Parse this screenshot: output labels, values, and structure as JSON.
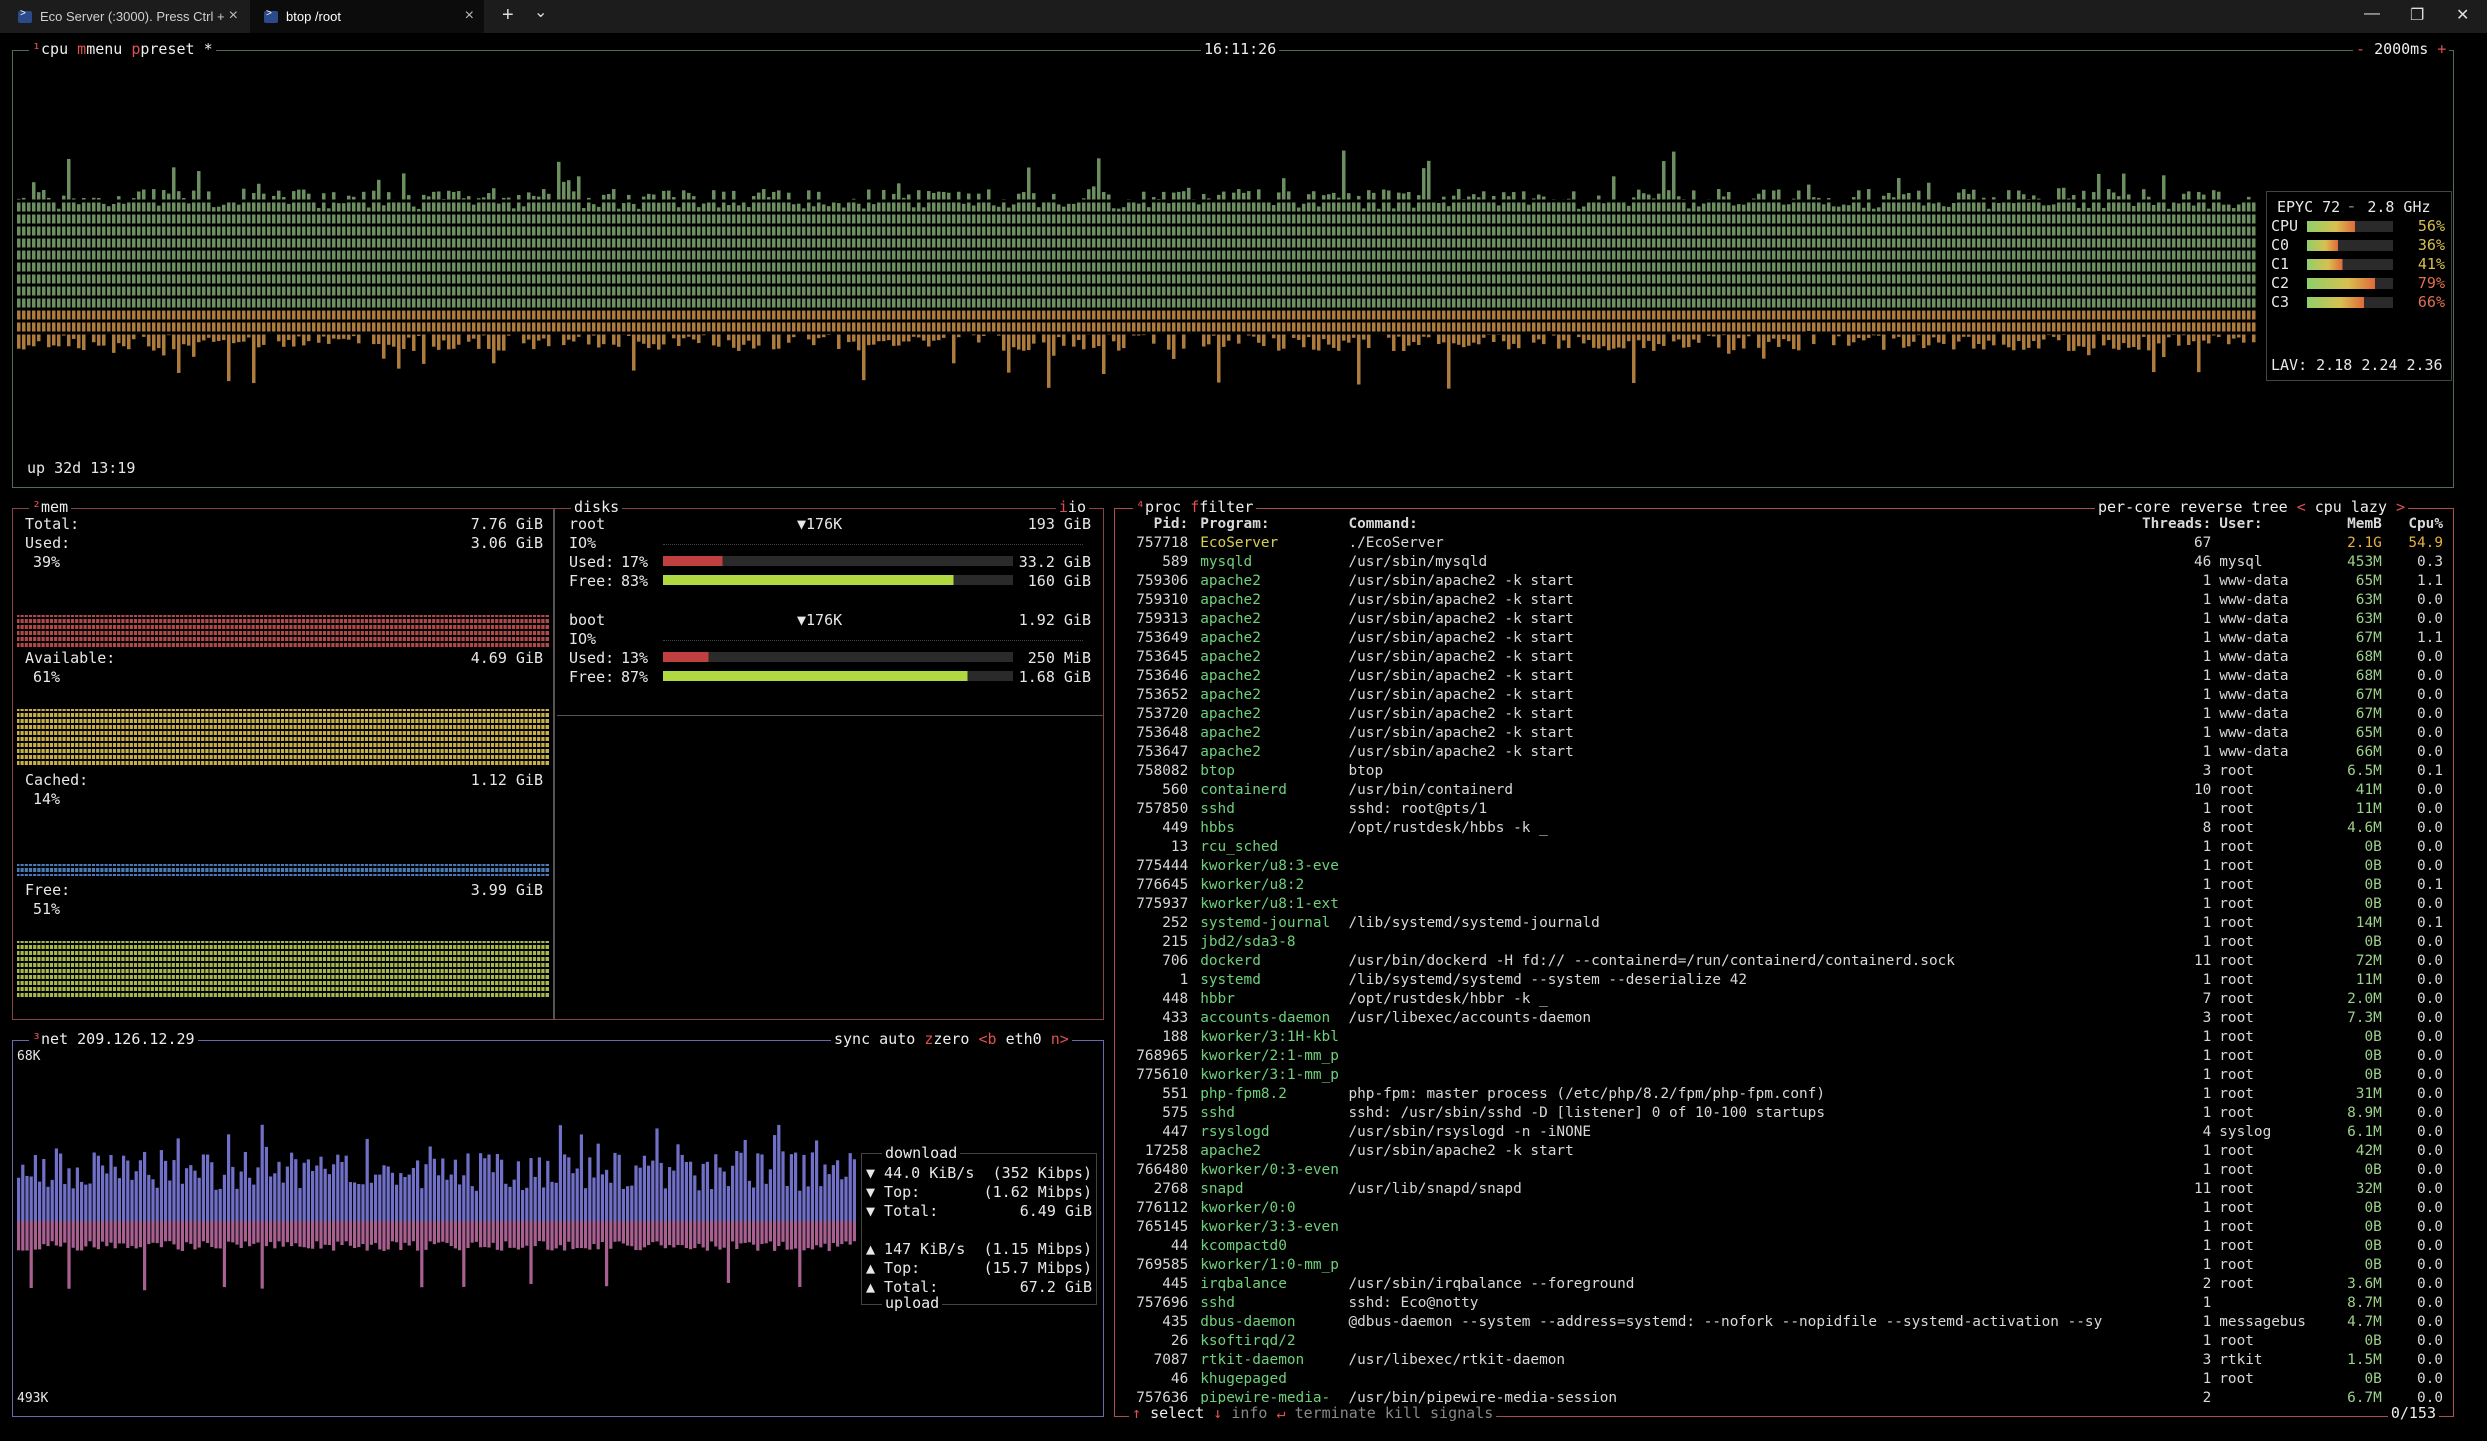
{
  "window": {
    "tabs": [
      {
        "label": "Eco Server (:3000). Press Ctrl +",
        "active": false
      },
      {
        "label": "btop /root",
        "active": true
      }
    ],
    "new_tab": "+",
    "dropdown": "⌄",
    "minimize": "—",
    "maximize": "❐",
    "close": "✕"
  },
  "cpu": {
    "title": "cpu",
    "menu": "menu",
    "preset": "preset *",
    "clock": "16:11:26",
    "interval": "2000ms",
    "uptime": "up 32d 13:19",
    "model": "EPYC 72",
    "freq": "2.8 GHz",
    "rows": [
      {
        "label": "CPU",
        "pct": "56%",
        "value": 56
      },
      {
        "label": "C0",
        "pct": "36%",
        "value": 36
      },
      {
        "label": "C1",
        "pct": "41%",
        "value": 41
      },
      {
        "label": "C2",
        "pct": "79%",
        "value": 79
      },
      {
        "label": "C3",
        "pct": "66%",
        "value": 66
      }
    ],
    "lav_label": "LAV:",
    "lav": [
      "2.18",
      "2.24",
      "2.36"
    ]
  },
  "mem": {
    "title": "mem",
    "total_label": "Total:",
    "total": "7.76 GiB",
    "used_label": "Used:",
    "used": "3.06 GiB",
    "used_pct": "39%",
    "available_label": "Available:",
    "available": "4.69 GiB",
    "available_pct": "61%",
    "cached_label": "Cached:",
    "cached": "1.12 GiB",
    "cached_pct": "14%",
    "free_label": "Free:",
    "free": "3.99 GiB",
    "free_pct": "51%"
  },
  "disks": {
    "title": "disks",
    "io_tag": "io",
    "items": [
      {
        "name": "root",
        "io_val": "▼176K",
        "size": "193 GiB",
        "io_label": "IO%",
        "used_label": "Used:",
        "used_pct": "17%",
        "used": "33.2 GiB",
        "used_frac": 0.17,
        "free_label": "Free:",
        "free_pct": "83%",
        "free": "160 GiB",
        "free_frac": 0.83
      },
      {
        "name": "boot",
        "io_val": "▼176K",
        "size": "1.92 GiB",
        "io_label": "IO%",
        "used_label": "Used:",
        "used_pct": "13%",
        "used": "250 MiB",
        "used_frac": 0.13,
        "free_label": "Free:",
        "free_pct": "87%",
        "free": "1.68 GiB",
        "free_frac": 0.87
      }
    ]
  },
  "net": {
    "title": "net",
    "ip": "209.126.12.29",
    "sync": "sync",
    "auto": "auto",
    "zero": "zero",
    "prev": "<b",
    "iface": "eth0",
    "next": "n>",
    "scale_top": "68K",
    "scale_bottom": "493K",
    "download_label": "download",
    "upload_label": "upload",
    "down_rate": "▼ 44.0 KiB/s",
    "down_rate_bits": "(352 Kibps)",
    "down_top_label": "▼ Top:",
    "down_top": "(1.62 Mibps)",
    "down_total_label": "▼ Total:",
    "down_total": "6.49 GiB",
    "up_rate": "▲ 147 KiB/s",
    "up_rate_bits": "(1.15 Mibps)",
    "up_top_label": "▲ Top:",
    "up_top": "(15.7 Mibps)",
    "up_total_label": "▲ Total:",
    "up_total": "67.2 GiB"
  },
  "proc": {
    "title": "proc",
    "filter": "filter",
    "per_core": "per-core",
    "reverse": "reverse",
    "tree": "tree",
    "sort": "cpu lazy",
    "headers": {
      "pid": "Pid:",
      "program": "Program:",
      "command": "Command:",
      "threads": "Threads:",
      "user": "User:",
      "memb": "MemB",
      "cpu": "Cpu%"
    },
    "rows": [
      [
        "757718",
        "EcoServer",
        "./EcoServer",
        "67",
        "",
        "2.1G",
        "54.9"
      ],
      [
        "589",
        "mysqld",
        "/usr/sbin/mysqld",
        "46",
        "mysql",
        "453M",
        "0.3"
      ],
      [
        "759306",
        "apache2",
        "/usr/sbin/apache2 -k start",
        "1",
        "www-data",
        "65M",
        "1.1"
      ],
      [
        "759310",
        "apache2",
        "/usr/sbin/apache2 -k start",
        "1",
        "www-data",
        "63M",
        "0.0"
      ],
      [
        "759313",
        "apache2",
        "/usr/sbin/apache2 -k start",
        "1",
        "www-data",
        "63M",
        "0.0"
      ],
      [
        "753649",
        "apache2",
        "/usr/sbin/apache2 -k start",
        "1",
        "www-data",
        "67M",
        "1.1"
      ],
      [
        "753645",
        "apache2",
        "/usr/sbin/apache2 -k start",
        "1",
        "www-data",
        "68M",
        "0.0"
      ],
      [
        "753646",
        "apache2",
        "/usr/sbin/apache2 -k start",
        "1",
        "www-data",
        "68M",
        "0.0"
      ],
      [
        "753652",
        "apache2",
        "/usr/sbin/apache2 -k start",
        "1",
        "www-data",
        "67M",
        "0.0"
      ],
      [
        "753720",
        "apache2",
        "/usr/sbin/apache2 -k start",
        "1",
        "www-data",
        "67M",
        "0.0"
      ],
      [
        "753648",
        "apache2",
        "/usr/sbin/apache2 -k start",
        "1",
        "www-data",
        "65M",
        "0.0"
      ],
      [
        "753647",
        "apache2",
        "/usr/sbin/apache2 -k start",
        "1",
        "www-data",
        "66M",
        "0.0"
      ],
      [
        "758082",
        "btop",
        "btop",
        "3",
        "root",
        "6.5M",
        "0.1"
      ],
      [
        "560",
        "containerd",
        "/usr/bin/containerd",
        "10",
        "root",
        "41M",
        "0.0"
      ],
      [
        "757850",
        "sshd",
        "sshd: root@pts/1",
        "1",
        "root",
        "11M",
        "0.0"
      ],
      [
        "449",
        "hbbs",
        "/opt/rustdesk/hbbs -k _",
        "8",
        "root",
        "4.6M",
        "0.0"
      ],
      [
        "13",
        "rcu_sched",
        "",
        "1",
        "root",
        "0B",
        "0.0"
      ],
      [
        "775444",
        "kworker/u8:3-eve",
        "",
        "1",
        "root",
        "0B",
        "0.0"
      ],
      [
        "776645",
        "kworker/u8:2",
        "",
        "1",
        "root",
        "0B",
        "0.1"
      ],
      [
        "775937",
        "kworker/u8:1-ext",
        "",
        "1",
        "root",
        "0B",
        "0.0"
      ],
      [
        "252",
        "systemd-journal",
        "/lib/systemd/systemd-journald",
        "1",
        "root",
        "14M",
        "0.1"
      ],
      [
        "215",
        "jbd2/sda3-8",
        "",
        "1",
        "root",
        "0B",
        "0.0"
      ],
      [
        "706",
        "dockerd",
        "/usr/bin/dockerd -H fd:// --containerd=/run/containerd/containerd.sock",
        "11",
        "root",
        "72M",
        "0.0"
      ],
      [
        "1",
        "systemd",
        "/lib/systemd/systemd --system --deserialize 42",
        "1",
        "root",
        "11M",
        "0.0"
      ],
      [
        "448",
        "hbbr",
        "/opt/rustdesk/hbbr -k _",
        "7",
        "root",
        "2.0M",
        "0.0"
      ],
      [
        "433",
        "accounts-daemon",
        "/usr/libexec/accounts-daemon",
        "3",
        "root",
        "7.3M",
        "0.0"
      ],
      [
        "188",
        "kworker/3:1H-kbl",
        "",
        "1",
        "root",
        "0B",
        "0.0"
      ],
      [
        "768965",
        "kworker/2:1-mm_p",
        "",
        "1",
        "root",
        "0B",
        "0.0"
      ],
      [
        "775610",
        "kworker/3:1-mm_p",
        "",
        "1",
        "root",
        "0B",
        "0.0"
      ],
      [
        "551",
        "php-fpm8.2",
        "php-fpm: master process (/etc/php/8.2/fpm/php-fpm.conf)",
        "1",
        "root",
        "31M",
        "0.0"
      ],
      [
        "575",
        "sshd",
        "sshd: /usr/sbin/sshd -D [listener] 0 of 10-100 startups",
        "1",
        "root",
        "8.9M",
        "0.0"
      ],
      [
        "447",
        "rsyslogd",
        "/usr/sbin/rsyslogd -n -iNONE",
        "4",
        "syslog",
        "6.1M",
        "0.0"
      ],
      [
        "17258",
        "apache2",
        "/usr/sbin/apache2 -k start",
        "1",
        "root",
        "42M",
        "0.0"
      ],
      [
        "766480",
        "kworker/0:3-even",
        "",
        "1",
        "root",
        "0B",
        "0.0"
      ],
      [
        "2768",
        "snapd",
        "/usr/lib/snapd/snapd",
        "11",
        "root",
        "32M",
        "0.0"
      ],
      [
        "776112",
        "kworker/0:0",
        "",
        "1",
        "root",
        "0B",
        "0.0"
      ],
      [
        "765145",
        "kworker/3:3-even",
        "",
        "1",
        "root",
        "0B",
        "0.0"
      ],
      [
        "44",
        "kcompactd0",
        "",
        "1",
        "root",
        "0B",
        "0.0"
      ],
      [
        "769585",
        "kworker/1:0-mm_p",
        "",
        "1",
        "root",
        "0B",
        "0.0"
      ],
      [
        "445",
        "irqbalance",
        "/usr/sbin/irqbalance --foreground",
        "2",
        "root",
        "3.6M",
        "0.0"
      ],
      [
        "757696",
        "sshd",
        "sshd: Eco@notty",
        "1",
        "",
        "8.7M",
        "0.0"
      ],
      [
        "435",
        "dbus-daemon",
        "@dbus-daemon --system --address=systemd: --nofork --nopidfile --systemd-activation --sy",
        "1",
        "messagebus",
        "4.7M",
        "0.0"
      ],
      [
        "26",
        "ksoftirqd/2",
        "",
        "1",
        "root",
        "0B",
        "0.0"
      ],
      [
        "7087",
        "rtkit-daemon",
        "/usr/libexec/rtkit-daemon",
        "3",
        "rtkit",
        "1.5M",
        "0.0"
      ],
      [
        "46",
        "khugepaged",
        "",
        "1",
        "root",
        "0B",
        "0.0"
      ],
      [
        "757636",
        "pipewire-media-",
        "/usr/bin/pipewire-media-session",
        "2",
        "",
        "6.7M",
        "0.0"
      ]
    ],
    "footer": {
      "select": "select",
      "info": "info",
      "terminate": "terminate",
      "kill": "kill",
      "signals": "signals",
      "count": "0/153"
    }
  },
  "colors": {
    "background": "#000000",
    "cpu_box": "#556a55",
    "mem_box": "#884444",
    "net_box": "#6a6aa8",
    "proc_box": "#a65050",
    "graph_green": "#9ad78a",
    "graph_orange": "#e08a3a",
    "program_green": "#6fd07a"
  }
}
